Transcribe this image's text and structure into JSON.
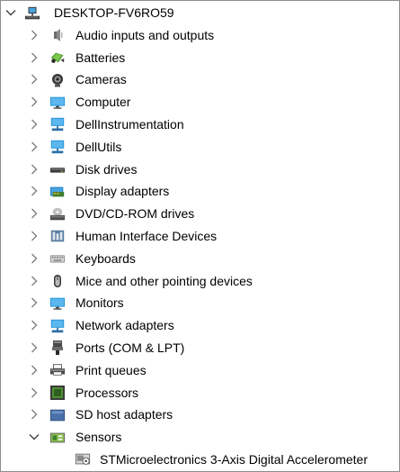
{
  "root": {
    "label": "DESKTOP-FV6RO59",
    "expanded": true,
    "icon": "computer-root-icon"
  },
  "categories": [
    {
      "label": "Audio inputs and outputs",
      "icon": "speaker-icon",
      "expanded": false
    },
    {
      "label": "Batteries",
      "icon": "battery-icon",
      "expanded": false
    },
    {
      "label": "Cameras",
      "icon": "camera-icon",
      "expanded": false
    },
    {
      "label": "Computer",
      "icon": "monitor-icon",
      "expanded": false
    },
    {
      "label": "DellInstrumentation",
      "icon": "network-device-icon",
      "expanded": false
    },
    {
      "label": "DellUtils",
      "icon": "network-device-icon",
      "expanded": false
    },
    {
      "label": "Disk drives",
      "icon": "disk-drive-icon",
      "expanded": false
    },
    {
      "label": "Display adapters",
      "icon": "display-adapter-icon",
      "expanded": false
    },
    {
      "label": "DVD/CD-ROM drives",
      "icon": "dvd-drive-icon",
      "expanded": false
    },
    {
      "label": "Human Interface Devices",
      "icon": "hid-icon",
      "expanded": false
    },
    {
      "label": "Keyboards",
      "icon": "keyboard-icon",
      "expanded": false
    },
    {
      "label": "Mice and other pointing devices",
      "icon": "mouse-icon",
      "expanded": false
    },
    {
      "label": "Monitors",
      "icon": "monitor-icon",
      "expanded": false
    },
    {
      "label": "Network adapters",
      "icon": "network-adapter-icon",
      "expanded": false
    },
    {
      "label": "Ports (COM & LPT)",
      "icon": "port-icon",
      "expanded": false
    },
    {
      "label": "Print queues",
      "icon": "printer-icon",
      "expanded": false
    },
    {
      "label": "Processors",
      "icon": "processor-icon",
      "expanded": false
    },
    {
      "label": "SD host adapters",
      "icon": "sd-adapter-icon",
      "expanded": false
    },
    {
      "label": "Sensors",
      "icon": "sensor-icon",
      "expanded": true,
      "children": [
        {
          "label": "STMicroelectronics 3-Axis Digital Accelerometer",
          "icon": "accelerometer-icon"
        }
      ]
    }
  ],
  "colors": {
    "chevron": "#7a7a7a",
    "monitor_blue": "#1e90d6",
    "border": "#8c8c8c"
  }
}
